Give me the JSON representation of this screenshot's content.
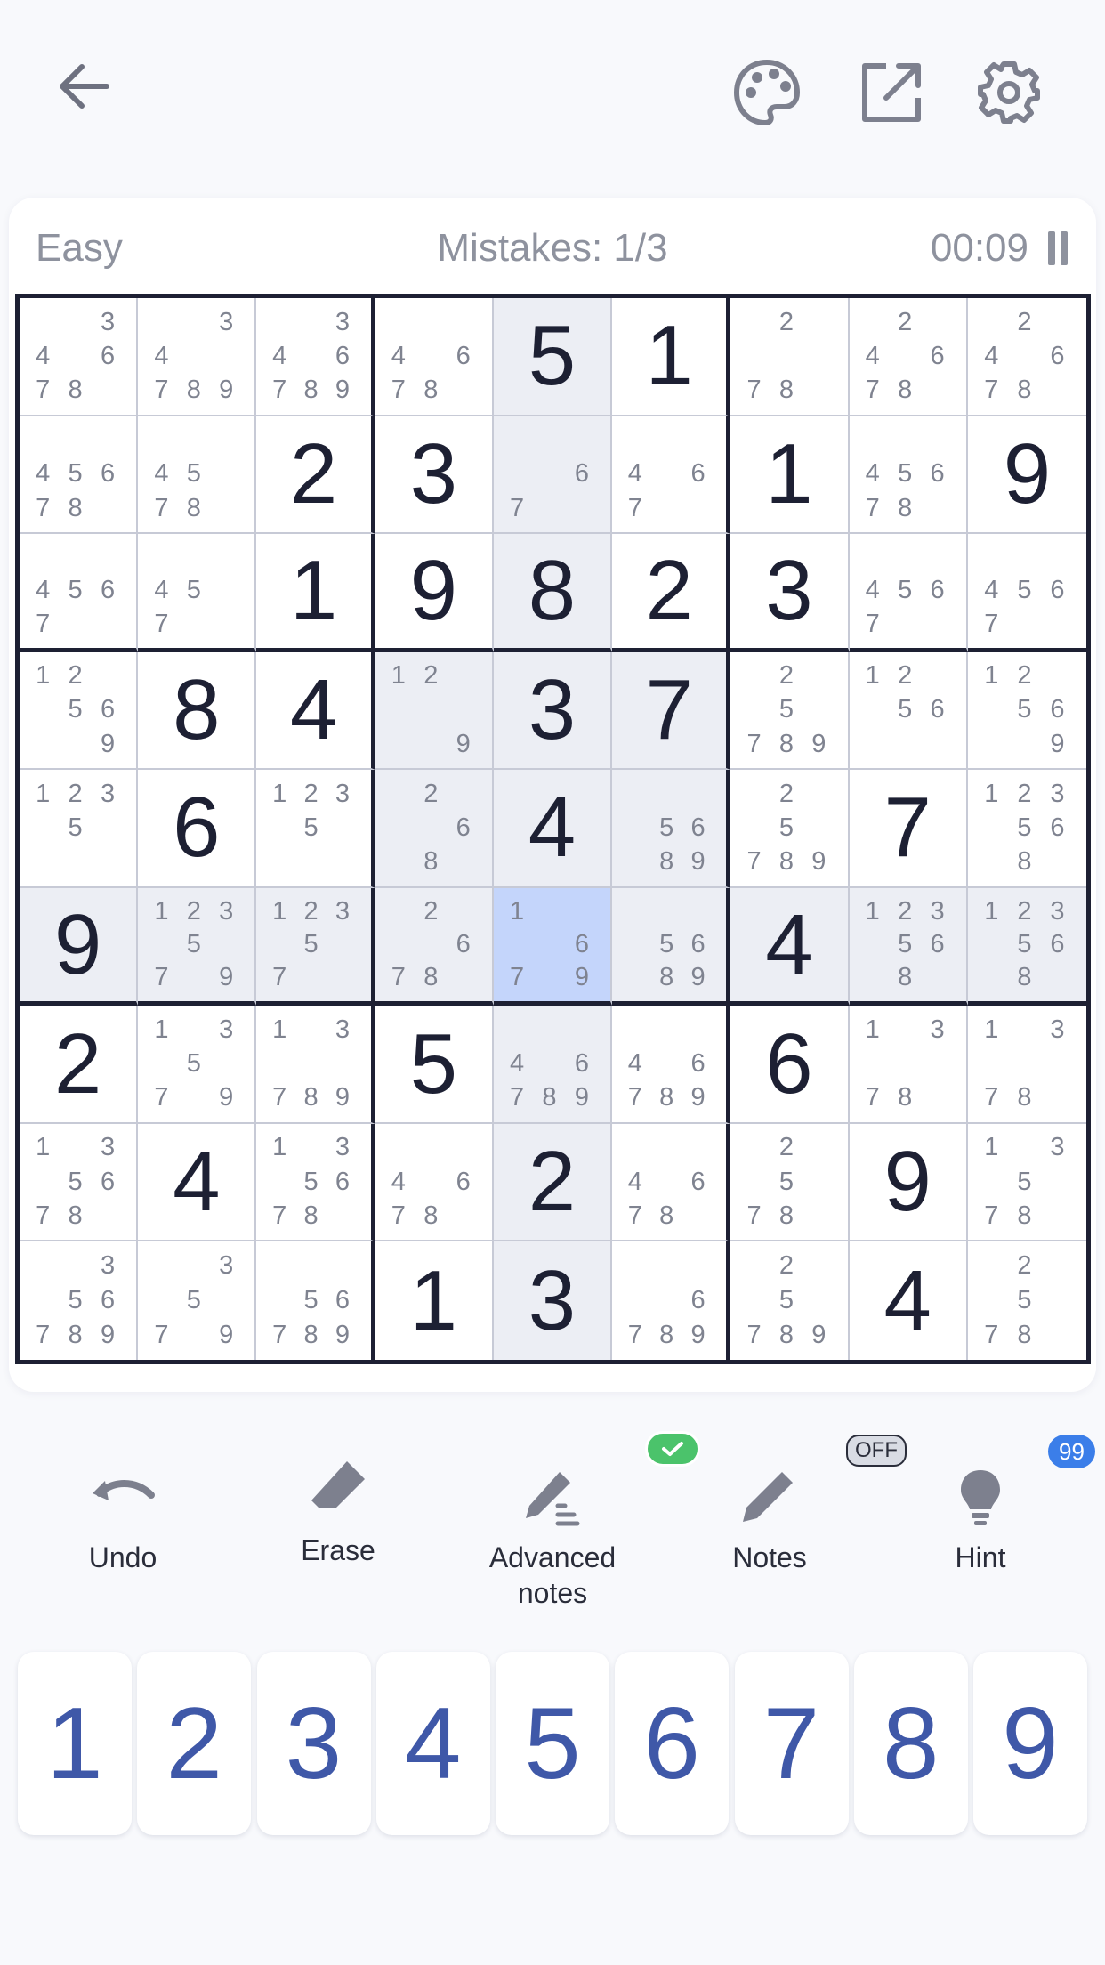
{
  "header": {
    "back_icon": "arrow-left-icon",
    "palette_icon": "palette-icon",
    "share_icon": "external-link-icon",
    "settings_icon": "gear-icon"
  },
  "status": {
    "difficulty": "Easy",
    "mistakes": "Mistakes: 1/3",
    "timer": "00:09"
  },
  "board": {
    "selected": [
      5,
      4
    ],
    "rows": [
      [
        {
          "n": [
            3,
            4,
            6,
            7,
            8
          ]
        },
        {
          "n": [
            3,
            4,
            7,
            8,
            9
          ]
        },
        {
          "n": [
            3,
            4,
            6,
            7,
            8,
            9
          ]
        },
        {
          "n": [
            4,
            6,
            7,
            8
          ]
        },
        {
          "v": "5"
        },
        {
          "v": "1"
        },
        {
          "n": [
            2,
            7,
            8
          ]
        },
        {
          "n": [
            2,
            4,
            6,
            7,
            8
          ]
        },
        {
          "n": [
            2,
            4,
            6,
            7,
            8
          ]
        }
      ],
      [
        {
          "n": [
            4,
            5,
            6,
            7,
            8
          ]
        },
        {
          "n": [
            4,
            5,
            7,
            8
          ]
        },
        {
          "v": "2"
        },
        {
          "v": "3"
        },
        {
          "n": [
            6,
            7
          ]
        },
        {
          "n": [
            4,
            6,
            7
          ]
        },
        {
          "v": "1"
        },
        {
          "n": [
            4,
            5,
            6,
            7,
            8
          ]
        },
        {
          "v": "9"
        }
      ],
      [
        {
          "n": [
            4,
            5,
            6,
            7
          ]
        },
        {
          "n": [
            4,
            5,
            7
          ]
        },
        {
          "v": "1"
        },
        {
          "v": "9"
        },
        {
          "v": "8"
        },
        {
          "v": "2"
        },
        {
          "v": "3"
        },
        {
          "n": [
            4,
            5,
            6,
            7
          ]
        },
        {
          "n": [
            4,
            5,
            6,
            7
          ]
        }
      ],
      [
        {
          "n": [
            1,
            2,
            5,
            6,
            9
          ]
        },
        {
          "v": "8"
        },
        {
          "v": "4"
        },
        {
          "n": [
            1,
            2,
            9
          ]
        },
        {
          "v": "3"
        },
        {
          "v": "7"
        },
        {
          "n": [
            2,
            5,
            7,
            8,
            9
          ]
        },
        {
          "n": [
            1,
            2,
            5,
            6
          ]
        },
        {
          "n": [
            1,
            2,
            5,
            6,
            9
          ]
        }
      ],
      [
        {
          "n": [
            1,
            2,
            3,
            5
          ]
        },
        {
          "v": "6"
        },
        {
          "n": [
            1,
            2,
            3,
            5
          ]
        },
        {
          "n": [
            2,
            6,
            8
          ]
        },
        {
          "v": "4"
        },
        {
          "n": [
            5,
            6,
            8,
            9
          ]
        },
        {
          "n": [
            2,
            5,
            7,
            8,
            9
          ]
        },
        {
          "v": "7"
        },
        {
          "n": [
            1,
            2,
            3,
            5,
            6,
            8
          ]
        }
      ],
      [
        {
          "v": "9"
        },
        {
          "n": [
            1,
            2,
            3,
            5,
            7,
            9
          ]
        },
        {
          "n": [
            1,
            2,
            3,
            5,
            7
          ]
        },
        {
          "n": [
            2,
            6,
            7,
            8
          ]
        },
        {
          "n": [
            1,
            6,
            7,
            9
          ]
        },
        {
          "n": [
            5,
            6,
            8,
            9
          ]
        },
        {
          "v": "4"
        },
        {
          "n": [
            1,
            2,
            3,
            5,
            6,
            8
          ]
        },
        {
          "n": [
            1,
            2,
            3,
            5,
            6,
            8
          ]
        }
      ],
      [
        {
          "v": "2"
        },
        {
          "n": [
            1,
            3,
            5,
            7,
            9
          ]
        },
        {
          "n": [
            1,
            3,
            7,
            8,
            9
          ]
        },
        {
          "v": "5"
        },
        {
          "n": [
            4,
            6,
            7,
            8,
            9
          ]
        },
        {
          "n": [
            4,
            6,
            7,
            8,
            9
          ]
        },
        {
          "v": "6"
        },
        {
          "n": [
            1,
            3,
            7,
            8
          ]
        },
        {
          "n": [
            1,
            3,
            7,
            8
          ]
        }
      ],
      [
        {
          "n": [
            1,
            3,
            5,
            6,
            7,
            8
          ]
        },
        {
          "v": "4"
        },
        {
          "n": [
            1,
            3,
            5,
            6,
            7,
            8
          ]
        },
        {
          "n": [
            4,
            6,
            7,
            8
          ]
        },
        {
          "v": "2"
        },
        {
          "n": [
            4,
            6,
            7,
            8
          ]
        },
        {
          "n": [
            2,
            5,
            7,
            8
          ]
        },
        {
          "v": "9"
        },
        {
          "n": [
            1,
            3,
            5,
            7,
            8
          ]
        }
      ],
      [
        {
          "n": [
            3,
            5,
            6,
            7,
            8,
            9
          ]
        },
        {
          "n": [
            3,
            5,
            7,
            9
          ]
        },
        {
          "n": [
            5,
            6,
            7,
            8,
            9
          ]
        },
        {
          "v": "1"
        },
        {
          "v": "3"
        },
        {
          "n": [
            6,
            7,
            8,
            9
          ]
        },
        {
          "n": [
            2,
            5,
            7,
            8,
            9
          ]
        },
        {
          "v": "4"
        },
        {
          "n": [
            2,
            5,
            7,
            8
          ]
        }
      ]
    ]
  },
  "tools": {
    "undo": "Undo",
    "erase": "Erase",
    "advanced_line1": "Advanced",
    "advanced_line2": "notes",
    "notes": "Notes",
    "notes_badge": "OFF",
    "hint": "Hint",
    "hint_badge": "99",
    "badge_color_green": "#4bc36b",
    "badge_color_blue": "#3b7ee9"
  },
  "numpad": [
    "1",
    "2",
    "3",
    "4",
    "5",
    "6",
    "7",
    "8",
    "9"
  ]
}
